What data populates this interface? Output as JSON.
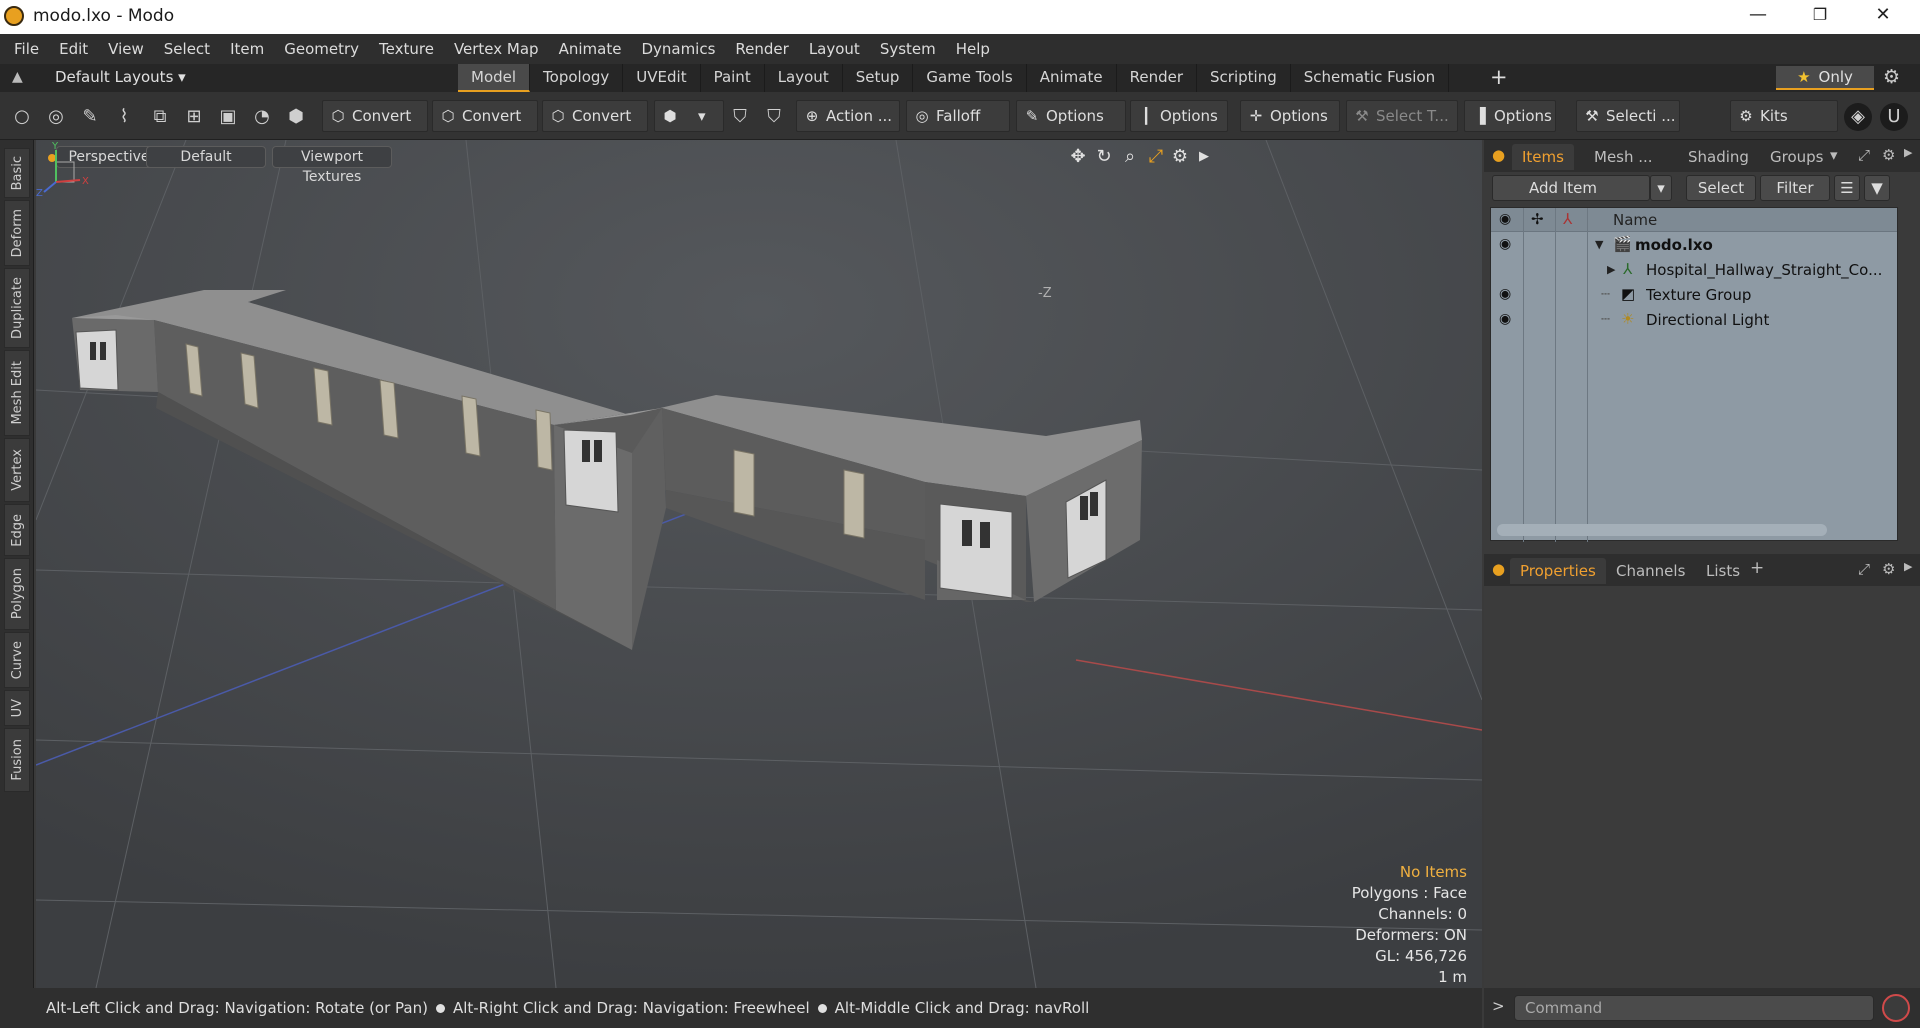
{
  "window": {
    "title": "modo.lxo - Modo",
    "minimize": "—",
    "maximize": "❐",
    "close": "✕"
  },
  "menu": [
    "File",
    "Edit",
    "View",
    "Select",
    "Item",
    "Geometry",
    "Texture",
    "Vertex Map",
    "Animate",
    "Dynamics",
    "Render",
    "Layout",
    "System",
    "Help"
  ],
  "layoutbar": {
    "layouts_label": "Default Layouts ▾",
    "tabs": [
      "Model",
      "Topology",
      "UVEdit",
      "Paint",
      "Layout",
      "Setup",
      "Game Tools",
      "Animate",
      "Render",
      "Scripting",
      "Schematic Fusion"
    ],
    "active_tab": "Model",
    "only_label": "Only"
  },
  "toolbar": {
    "convert1": "Convert",
    "convert2": "Convert",
    "convert3": "Convert",
    "action": "Action ...",
    "falloff": "Falloff",
    "options1": "Options",
    "options2": "Options",
    "options3": "Options",
    "select_t": "Select T...",
    "options4": "Options",
    "selecti": "Selecti ...",
    "kits": "Kits"
  },
  "left_tabs": [
    "Basic",
    "Deform",
    "Duplicate",
    "Mesh Edit",
    "Vertex",
    "Edge",
    "Polygon",
    "Curve",
    "UV",
    "Fusion"
  ],
  "viewport": {
    "view_mode": "Perspective",
    "shading": "Default",
    "textures": "Viewport Textures",
    "axis_label": "-Z",
    "info": {
      "selection": "No Items",
      "polygons": "Polygons : Face",
      "channels": "Channels: 0",
      "deformers": "Deformers: ON",
      "gl": "GL: 456,726",
      "scale": "1 m"
    }
  },
  "items_panel": {
    "tabs": [
      "Items",
      "Mesh ...",
      "Shading",
      "Groups"
    ],
    "active_tab": "Items",
    "add_item": "Add Item",
    "select": "Select",
    "filter": "Filter",
    "column_name": "Name",
    "rows": [
      {
        "label": "modo.lxo",
        "visible": true
      },
      {
        "label": "Hospital_Hallway_Straight_Co...",
        "visible": false
      },
      {
        "label": "Texture Group",
        "visible": true
      },
      {
        "label": "Directional Light",
        "visible": true
      }
    ]
  },
  "properties_panel": {
    "tabs": [
      "Properties",
      "Channels",
      "Lists"
    ],
    "active_tab": "Properties"
  },
  "statusbar": {
    "hint1": "Alt-Left Click and Drag: Navigation: Rotate (or Pan)",
    "hint2": "Alt-Right Click and Drag: Navigation: Freewheel",
    "hint3": "Alt-Middle Click and Drag: navRoll"
  },
  "command": {
    "prompt": ">",
    "placeholder": "Command"
  },
  "colors": {
    "accent": "#e8a020",
    "viewport_bg": "#47494c",
    "outliner_bg": "#8e9aa4"
  }
}
